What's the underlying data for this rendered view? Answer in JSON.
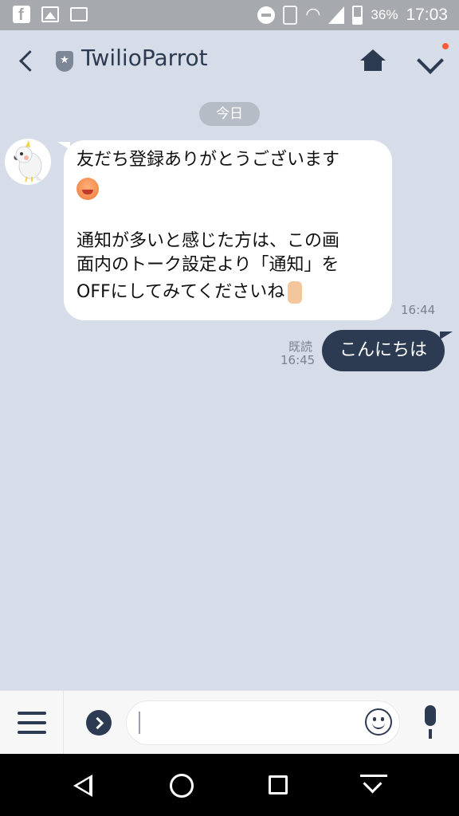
{
  "statusbar": {
    "battery_percent": "36%",
    "time": "17:03",
    "icons": [
      "facebook-icon",
      "image-icon",
      "cast-icon",
      "dnd-icon",
      "vibrate-icon",
      "wifi-icon",
      "signal-icon",
      "battery-icon"
    ]
  },
  "header": {
    "title": "TwilioParrot",
    "back_icon": "chevron-left-icon",
    "badge_icon": "shield-star-icon",
    "home_icon": "home-icon",
    "collapse_icon": "chevron-down-icon",
    "notification_dot_color": "#ff5a36"
  },
  "chat": {
    "date_label": "今日",
    "incoming": {
      "lines": [
        "友だち登録ありがとうございます",
        "通知が多いと感じた方は、この画",
        "面内のトーク設定より「通知」を",
        "OFFにしてみてくださいね"
      ],
      "emojis": [
        "smiling-face-emoji",
        "thumbs-up-emoji"
      ],
      "time": "16:44"
    },
    "outgoing": {
      "text": "こんにちは",
      "read_label": "既読",
      "time": "16:45"
    }
  },
  "inputbar": {
    "menu_icon": "list-menu-icon",
    "expand_icon": "chevron-right-circle-icon",
    "emoji_icon": "smiley-icon",
    "mic_icon": "microphone-icon"
  },
  "navbar": {
    "icons": [
      "back-triangle-icon",
      "home-circle-icon",
      "recents-square-icon",
      "download-icon"
    ]
  },
  "colors": {
    "background": "#d7dde8",
    "accent": "#2c3b52",
    "incoming_bubble": "#ffffff",
    "outgoing_bubble": "#2c3b52"
  }
}
